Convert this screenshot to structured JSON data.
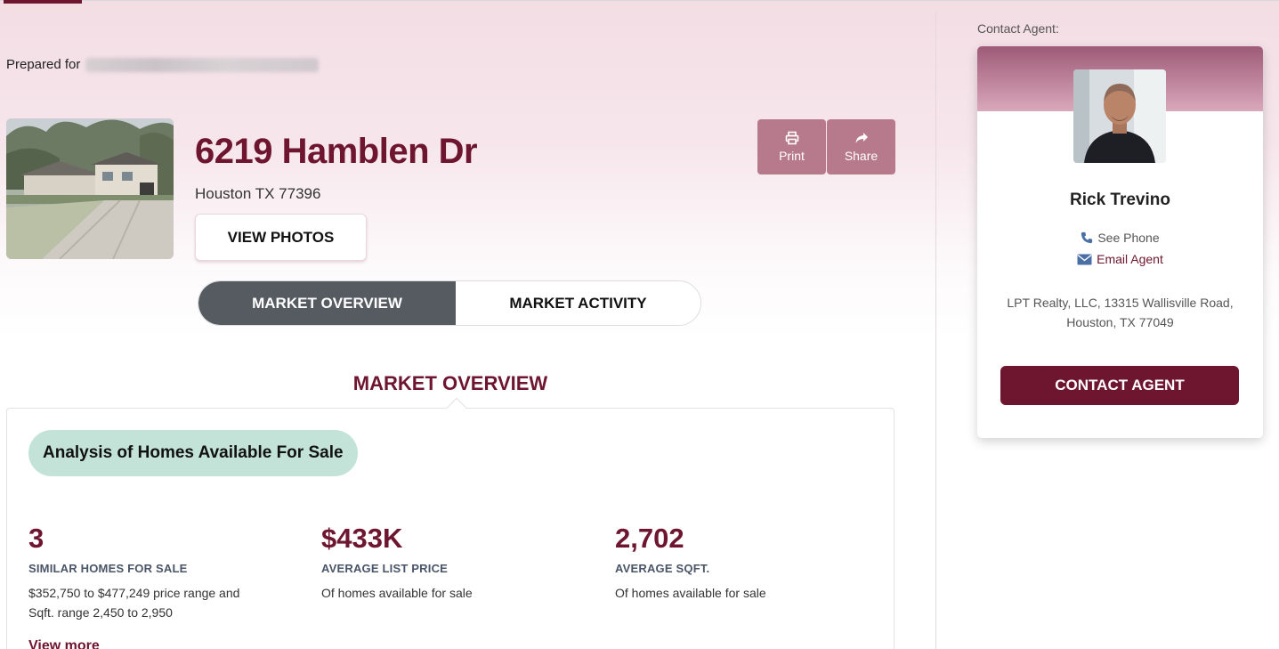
{
  "prepared_for": {
    "label": "Prepared for"
  },
  "property": {
    "address": "6219 Hamblen Dr",
    "city_line": "Houston TX 77396",
    "view_photos_label": "VIEW PHOTOS"
  },
  "toolbar": {
    "print_label": "Print",
    "share_label": "Share"
  },
  "tabs": [
    {
      "label": "MARKET OVERVIEW",
      "active": true
    },
    {
      "label": "MARKET ACTIVITY",
      "active": false
    }
  ],
  "section": {
    "title": "MARKET OVERVIEW",
    "pill": "Analysis of Homes Available For Sale",
    "stats": [
      {
        "value": "3",
        "label": "SIMILAR HOMES FOR SALE",
        "desc": "$352,750 to $477,249 price range and Sqft. range 2,450 to 2,950"
      },
      {
        "value": "$433K",
        "label": "AVERAGE LIST PRICE",
        "desc": "Of homes available for sale"
      },
      {
        "value": "2,702",
        "label": "AVERAGE SQFT.",
        "desc": "Of homes available for sale"
      }
    ],
    "view_more": "View more"
  },
  "agent": {
    "contact_label": "Contact Agent:",
    "name": "Rick Trevino",
    "see_phone": "See Phone",
    "email": "Email Agent",
    "office": "LPT Realty, LLC, 13315 Wallisville Road, Houston, TX 77049",
    "cta": "CONTACT AGENT"
  },
  "colors": {
    "brand": "#6e1530",
    "tab_active": "#565b62",
    "pill": "#c3e3d9",
    "tool_button": "#b77a8c"
  },
  "icons": [
    "print-icon",
    "share-icon",
    "phone-icon",
    "envelope-icon"
  ]
}
